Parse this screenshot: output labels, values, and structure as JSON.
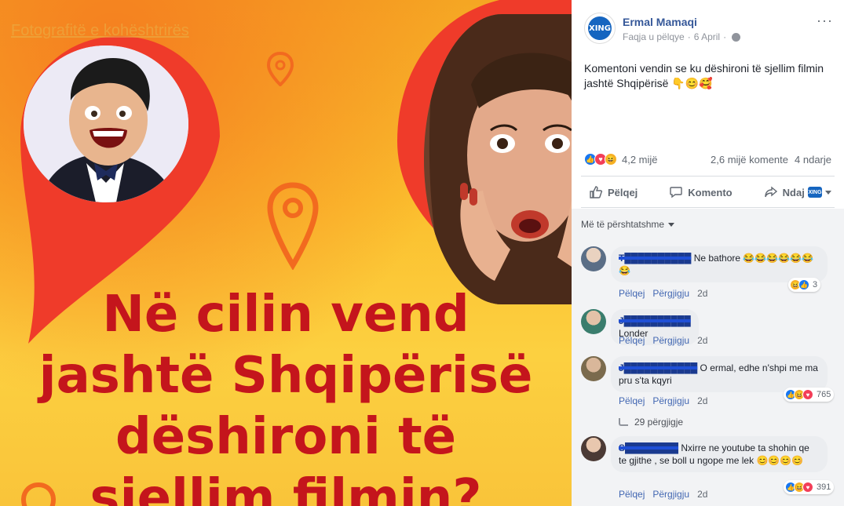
{
  "photo": {
    "faded_link": "Fotografitë e kohështrirës",
    "headline_lines": [
      "Në cilin vend",
      "jashtë Shqipërisë",
      "dëshironi të",
      "sjellim filmin?"
    ]
  },
  "post": {
    "page_name": "Ermal Mamaqi",
    "page_logo_text": "XING",
    "meta_label": "Faqja u pëlqye",
    "date": "6 April",
    "more_label": "···",
    "text": "Komentoni vendin se ku dëshironi të sjellim filmin jashtë Shqipërisë 👇😊🥰",
    "reactions_count": "4,2 mijë",
    "comments_count": "2,6 mijë komente",
    "shares_count": "4 ndarje",
    "actions": {
      "like": "Pëlqej",
      "comment": "Komento",
      "share": "Ndaj"
    },
    "sort_label": "Më të përshtatshme"
  },
  "comments": [
    {
      "author": "T██████████",
      "text": "Ne bathore 😂😂😂😂😂😂😂",
      "like": "Pëlqej",
      "reply": "Përgjigju",
      "time": "2d",
      "reaction_count": "3"
    },
    {
      "author": "J██████████",
      "text": "Londer",
      "like": "Pëlqej",
      "reply": "Përgjigju",
      "time": "2d"
    },
    {
      "author": "J███████████",
      "text": "O ermal, edhe n'shpi me ma pru s'ta kqyri",
      "like": "Pëlqej",
      "reply": "Përgjigju",
      "time": "2d",
      "reaction_count": "765",
      "replies": "29 përgjigje"
    },
    {
      "author": "S████████",
      "text": "Nxirre ne youtube ta shohin qe te gjithe , se boll u ngope me lek 😊😊😊😊",
      "like": "Pëlqej",
      "reply": "Përgjigju",
      "time": "2d",
      "reaction_count": "391"
    }
  ],
  "colors": {
    "link_blue": "#365899",
    "fb_blue": "#1877f2",
    "headline_red": "#c4151c",
    "pin_red": "#ef3b2a"
  }
}
